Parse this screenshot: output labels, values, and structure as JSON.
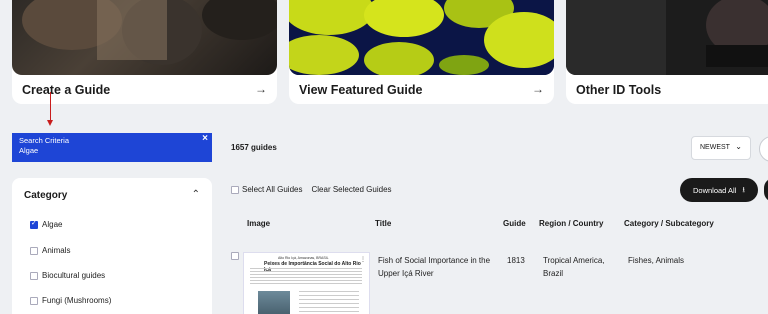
{
  "cards": [
    {
      "label": "Create a Guide",
      "arrow": "→"
    },
    {
      "label": "View Featured Guide",
      "arrow": "→"
    },
    {
      "label": "Other ID Tools"
    }
  ],
  "search_criteria": {
    "title": "Search Criteria",
    "value": "Algae",
    "close": "×"
  },
  "filter": {
    "title": "Category",
    "chevron": "⌃",
    "items": [
      {
        "label": "Algae",
        "checked": true
      },
      {
        "label": "Animals",
        "checked": false
      },
      {
        "label": "Biocultural guides",
        "checked": false
      },
      {
        "label": "Fungi (Mushrooms)",
        "checked": false
      }
    ]
  },
  "results": {
    "count": "1657 guides",
    "sort": "NEWEST",
    "sort_chevron": "⌄",
    "select_all": "Select All Guides",
    "clear_selected": "Clear Selected Guides",
    "download_all": "Download All",
    "download_icon": "⭳"
  },
  "table": {
    "headers": {
      "image": "Image",
      "title": "Title",
      "guide": "Guide",
      "region": "Region / Country",
      "category": "Category / Subcategory"
    },
    "rows": [
      {
        "title_line1": "Fish of Social Importance in the",
        "title_line2": "Upper Içá River",
        "guide": "1813",
        "region_line1": "Tropical America,",
        "region_line2": "Brazil",
        "category": "Fishes, Animals",
        "thumb_header": "Alto Rio Içá, Amazonas, BRASIL",
        "thumb_title": "Peixes de Importância Social do Alto Rio Içá",
        "thumb_more": "⋮"
      }
    ]
  }
}
